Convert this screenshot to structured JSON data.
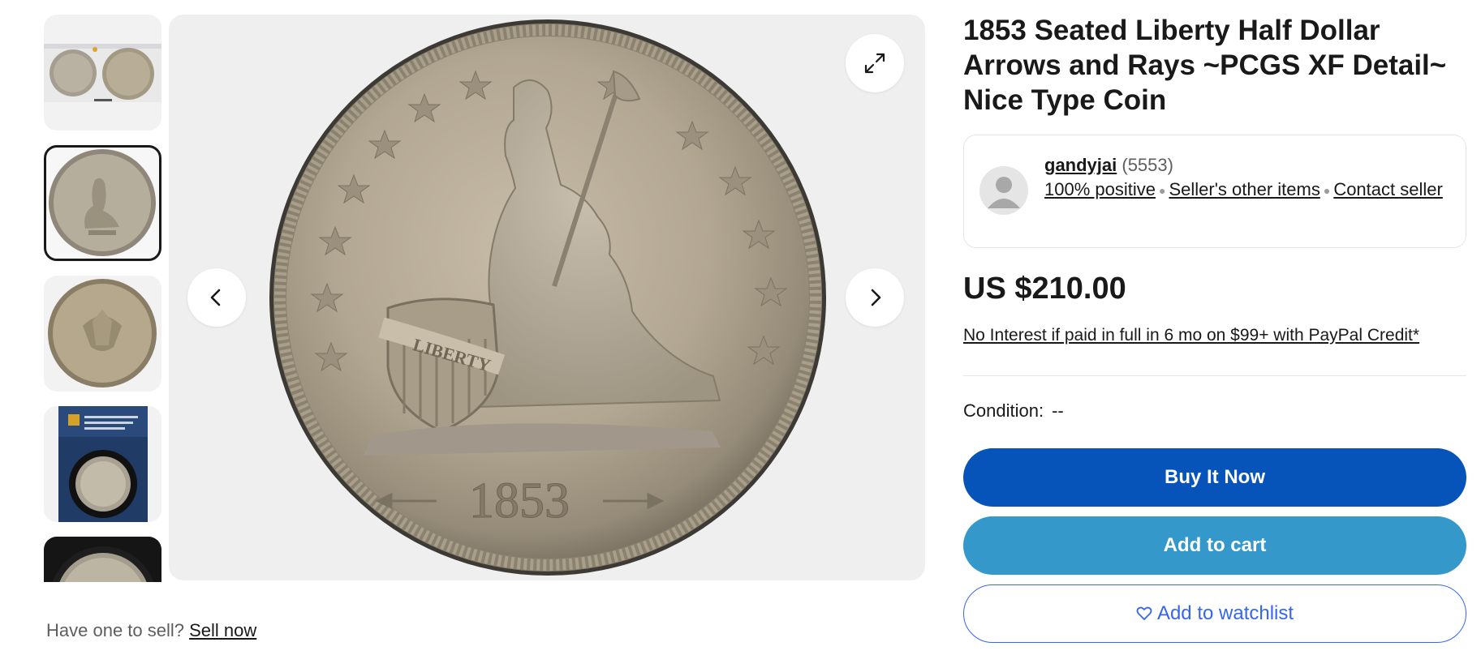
{
  "thumbnails": [
    {
      "label": "slab front and back"
    },
    {
      "label": "obverse"
    },
    {
      "label": "reverse"
    },
    {
      "label": "PCGS holder"
    },
    {
      "label": "obverse in holder"
    }
  ],
  "main_image": {
    "coin_date": "1853",
    "shield_text": "LIBERTY",
    "expand_icon": "expand-icon",
    "prev_icon": "chevron-left-icon",
    "next_icon": "chevron-right-icon"
  },
  "sell": {
    "prompt": "Have one to sell?",
    "link": "Sell now"
  },
  "listing": {
    "title": "1853 Seated Liberty Half Dollar Arrows and Rays ~PCGS XF Detail~ Nice Type Coin",
    "price": "US $210.00",
    "credit_offer": "No Interest if paid in full in 6 mo on $99+ with PayPal Credit*",
    "condition_label": "Condition:",
    "condition_value": "--"
  },
  "seller": {
    "name": "gandyjai",
    "feedback_count": "(5553)",
    "positive": "100% positive",
    "other_items": "Seller's other items",
    "contact": "Contact seller"
  },
  "actions": {
    "buy_now": "Buy It Now",
    "add_to_cart": "Add to cart",
    "watchlist": "Add to watchlist"
  },
  "colors": {
    "buy_now": "#0654ba",
    "add_to_cart": "#3498ca",
    "watchlist": "#3665f3"
  }
}
